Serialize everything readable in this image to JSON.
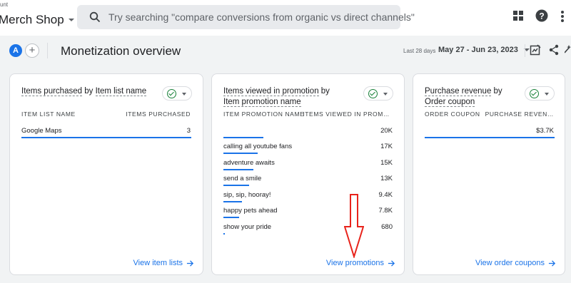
{
  "header": {
    "account_crumb": "unt",
    "property_name": "Merch Shop",
    "search_placeholder": "Try searching \"compare conversions from organic vs direct channels\""
  },
  "subheader": {
    "avatar_letter": "A",
    "add_symbol": "+",
    "page_title": "Monetization overview",
    "date_prefix": "Last 28 days",
    "date_range": "May 27 - Jun 23, 2023"
  },
  "icons": {
    "search": "search-icon",
    "apps": "apps-grid-icon",
    "help": "help-icon",
    "more": "more-vert-icon",
    "edit": "customize-report-icon",
    "share": "share-icon",
    "insights": "insights-icon",
    "check": "check-circle-icon",
    "arrow": "arrow-forward-icon"
  },
  "colors": {
    "accent": "#1a73e8",
    "success": "#188038",
    "annotation": "#e8231b"
  },
  "cards": [
    {
      "title_a": "Items purchased",
      "title_b": " by ",
      "title_c": "Item list name",
      "col1": "ITEM LIST NAME",
      "col2": "ITEMS PURCHASED",
      "rows": [
        {
          "label": "Google Maps",
          "value": "3",
          "share": 1.0
        }
      ],
      "link": "View item lists"
    },
    {
      "title_a": "Items viewed in promotion",
      "title_b": " by ",
      "title_c": "Item promotion name",
      "col1": "ITEM PROMOTION NAME",
      "col2": "ITEMS VIEWED IN PROM…",
      "rows": [
        {
          "label": "",
          "value": "20K",
          "share": 1.0
        },
        {
          "label": "calling all youtube fans",
          "value": "17K",
          "share": 0.85
        },
        {
          "label": "adventure awaits",
          "value": "15K",
          "share": 0.75
        },
        {
          "label": "send a smile",
          "value": "13K",
          "share": 0.65
        },
        {
          "label": "sip, sip, hooray!",
          "value": "9.4K",
          "share": 0.47
        },
        {
          "label": "happy pets ahead",
          "value": "7.8K",
          "share": 0.39
        },
        {
          "label": "show your pride",
          "value": "680",
          "share": 0.034
        }
      ],
      "link": "View promotions"
    },
    {
      "title_a": "Purchase revenue",
      "title_b": " by ",
      "title_c": "Order coupon",
      "col1": "ORDER COUPON",
      "col2": "PURCHASE REVEN…",
      "rows": [
        {
          "label": "",
          "value": "$3.7K",
          "share": 1.0
        }
      ],
      "link": "View order coupons"
    }
  ]
}
